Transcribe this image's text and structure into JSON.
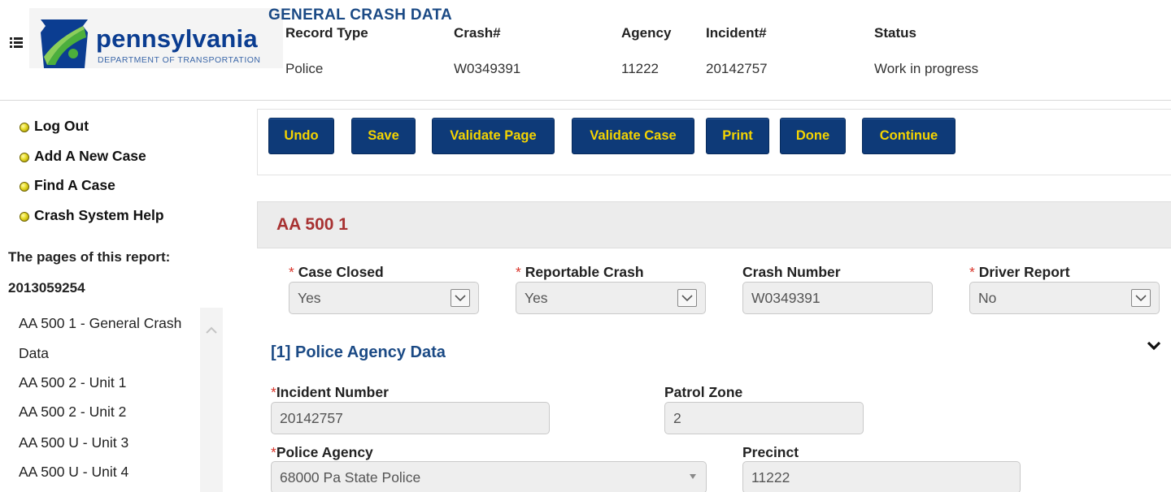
{
  "logo": {
    "name": "pennsylvania",
    "subtitle": "DEPARTMENT OF TRANSPORTATION"
  },
  "header": {
    "title": "GENERAL CRASH DATA",
    "columns": [
      {
        "label": "Record Type",
        "value": "Police"
      },
      {
        "label": "Crash#",
        "value": "W0349391"
      },
      {
        "label": "Agency",
        "value": "11222"
      },
      {
        "label": "Incident#",
        "value": "20142757"
      },
      {
        "label": "Status",
        "value": "Work in progress"
      }
    ]
  },
  "sidebar": {
    "links": [
      "Log Out",
      "Add A New Case",
      "Find A Case",
      "Crash System Help"
    ],
    "pages_heading": "The pages of this report:",
    "report_number": "2013059254",
    "pages": [
      "AA 500 1 - General Crash",
      "Data",
      "AA 500 2 - Unit 1",
      "AA 500 2 - Unit 2",
      "AA 500 U - Unit 3",
      "AA 500 U - Unit 4"
    ]
  },
  "toolbar": {
    "buttons": [
      "Undo",
      "Save",
      "Validate Page",
      "Validate Case",
      "Print",
      "Done",
      "Continue"
    ]
  },
  "form": {
    "title": "AA 500 1",
    "required_mark": "*",
    "case_closed": {
      "label": "Case Closed",
      "value": "Yes"
    },
    "reportable_crash": {
      "label": "Reportable Crash",
      "value": "Yes"
    },
    "crash_number": {
      "label": "Crash Number",
      "value": "W0349391"
    },
    "driver_report": {
      "label": "Driver Report",
      "value": "No"
    },
    "section_title": "[1] Police Agency Data",
    "incident_number": {
      "label": "Incident Number",
      "value": "20142757"
    },
    "patrol_zone": {
      "label": "Patrol Zone",
      "value": "2"
    },
    "police_agency": {
      "label": "Police Agency",
      "value": "68000 Pa State Police"
    },
    "precinct": {
      "label": "Precinct",
      "value": "11222"
    }
  },
  "colors": {
    "button_bg": "#0e3a78",
    "button_text": "#f5d400",
    "form_title": "#a83232",
    "section_title": "#1b4a85",
    "required": "#d9362b"
  },
  "icons": [
    "list-menu-icon",
    "penndot-keystone-logo-icon",
    "bullet-icon",
    "chevron-up-icon",
    "chevron-down-icon",
    "select-arrow-icon",
    "combo-caret-icon"
  ]
}
